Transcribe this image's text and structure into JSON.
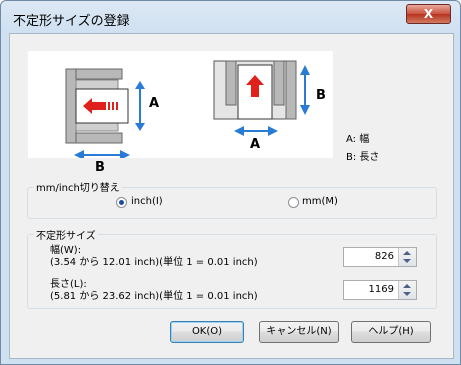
{
  "window": {
    "title": "不定形サイズの登録",
    "close_label": "X"
  },
  "illustration": {
    "label_a": "A",
    "label_b": "B",
    "legend_a": "A: 幅",
    "legend_b": "B: 長さ"
  },
  "units_group": {
    "label": "mm/inch切り替え",
    "options": [
      {
        "label": "inch(I)",
        "selected": true
      },
      {
        "label": "mm(M)",
        "selected": false
      }
    ]
  },
  "custom_size_group": {
    "label": "不定形サイズ",
    "width": {
      "label": "幅(W):",
      "range": "(3.54 から 12.01 inch)(単位 1 = 0.01 inch)",
      "value": "826"
    },
    "length": {
      "label": "長さ(L):",
      "range": "(5.81 から 23.62 inch)(単位 1 = 0.01 inch)",
      "value": "1169"
    }
  },
  "buttons": {
    "ok": "OK(O)",
    "cancel": "キャンセル(N)",
    "help": "ヘルプ(H)"
  },
  "colors": {
    "arrow_red": "#e0201a",
    "dimension_blue": "#2a7bd6"
  }
}
